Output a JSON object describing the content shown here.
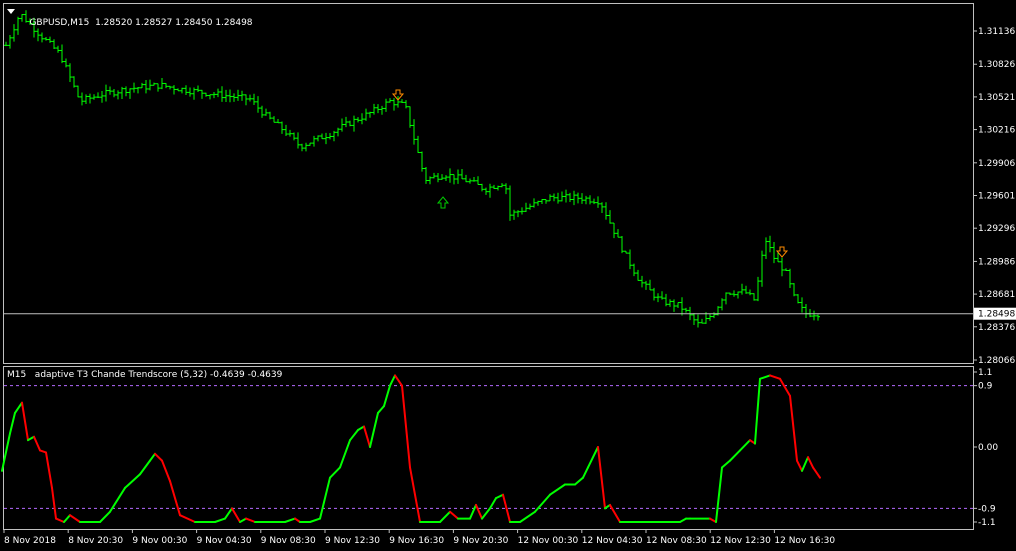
{
  "main_chart": {
    "symbol": "GBPUSD,M15",
    "ohlc": "1.28520 1.28527 1.28450 1.28498",
    "price_ticks": [
      "1.31136",
      "1.30826",
      "1.30521",
      "1.30216",
      "1.29906",
      "1.29601",
      "1.29296",
      "1.28986",
      "1.28681",
      "1.28376",
      "1.28066"
    ],
    "current_price": "1.28498",
    "bar_color": "#00ff00",
    "arrow_down_color": "#ff8c00",
    "arrow_up_color": "#00cc00"
  },
  "indicator": {
    "title": "M15   adaptive T3 Chande Trendscore (5,32) -0.4639 -0.4639",
    "levels": [
      "1.1",
      "0.9",
      "0.00",
      "-0.9",
      "-1.1"
    ],
    "up_color": "#00ff00",
    "down_color": "#ff0000",
    "level_color": "#b469ff"
  },
  "time_axis": [
    "8 Nov 2018",
    "8 Nov 20:30",
    "9 Nov 00:30",
    "9 Nov 04:30",
    "9 Nov 08:30",
    "9 Nov 12:30",
    "9 Nov 16:30",
    "9 Nov 20:30",
    "12 Nov 00:30",
    "12 Nov 04:30",
    "12 Nov 08:30",
    "12 Nov 12:30",
    "12 Nov 16:30"
  ],
  "chart_data": [
    {
      "type": "line",
      "title": "GBPUSD,M15",
      "ylim": [
        1.28066,
        1.3135
      ],
      "y_ticks": [
        1.31136,
        1.30826,
        1.30521,
        1.30216,
        1.29906,
        1.29601,
        1.29296,
        1.28986,
        1.28681,
        1.28376,
        1.28066
      ],
      "close_points": [
        [
          4,
          1.3096
        ],
        [
          20,
          1.313
        ],
        [
          40,
          1.311
        ],
        [
          60,
          1.3092
        ],
        [
          80,
          1.3048
        ],
        [
          100,
          1.3054
        ],
        [
          130,
          1.306
        ],
        [
          160,
          1.3063
        ],
        [
          190,
          1.3058
        ],
        [
          220,
          1.3054
        ],
        [
          250,
          1.305
        ],
        [
          265,
          1.3035
        ],
        [
          285,
          1.302
        ],
        [
          300,
          1.3006
        ],
        [
          330,
          1.3018
        ],
        [
          350,
          1.3028
        ],
        [
          370,
          1.3037
        ],
        [
          390,
          1.3048
        ],
        [
          405,
          1.3044
        ],
        [
          415,
          1.301
        ],
        [
          425,
          1.2975
        ],
        [
          445,
          1.298
        ],
        [
          470,
          1.2973
        ],
        [
          485,
          1.2966
        ],
        [
          505,
          1.2973
        ],
        [
          510,
          1.2942
        ],
        [
          530,
          1.295
        ],
        [
          550,
          1.2958
        ],
        [
          580,
          1.2958
        ],
        [
          600,
          1.2955
        ],
        [
          610,
          1.2935
        ],
        [
          625,
          1.2905
        ],
        [
          640,
          1.288
        ],
        [
          660,
          1.2862
        ],
        [
          680,
          1.2857
        ],
        [
          700,
          1.2838
        ],
        [
          715,
          1.2852
        ],
        [
          725,
          1.287
        ],
        [
          745,
          1.287
        ],
        [
          755,
          1.2862
        ],
        [
          765,
          1.292
        ],
        [
          775,
          1.29
        ],
        [
          785,
          1.289
        ],
        [
          795,
          1.2862
        ],
        [
          805,
          1.285
        ],
        [
          820,
          1.285
        ]
      ]
    },
    {
      "type": "line",
      "title": "adaptive T3 Chande Trendscore (5,32)",
      "ylim": [
        -1.1,
        1.1
      ],
      "y_ticks": [
        1.1,
        0.9,
        0.0,
        -0.9,
        -1.1
      ],
      "series": [
        {
          "values": [
            [
              2,
              -0.35
            ],
            [
              10,
              0.2
            ],
            [
              15,
              0.5
            ],
            [
              22,
              0.65
            ],
            [
              28,
              0.1
            ],
            [
              34,
              0.15
            ],
            [
              40,
              -0.05
            ],
            [
              46,
              -0.08
            ],
            [
              52,
              -0.6
            ],
            [
              56,
              -1.05
            ],
            [
              64,
              -1.1
            ],
            [
              70,
              -1.0
            ],
            [
              80,
              -1.1
            ],
            [
              100,
              -1.1
            ],
            [
              110,
              -0.95
            ],
            [
              125,
              -0.6
            ],
            [
              140,
              -0.4
            ],
            [
              150,
              -0.2
            ],
            [
              155,
              -0.1
            ],
            [
              162,
              -0.2
            ],
            [
              170,
              -0.5
            ],
            [
              180,
              -1.0
            ],
            [
              195,
              -1.1
            ],
            [
              215,
              -1.1
            ],
            [
              225,
              -1.05
            ],
            [
              232,
              -0.9
            ],
            [
              240,
              -1.1
            ],
            [
              246,
              -1.05
            ],
            [
              255,
              -1.1
            ],
            [
              285,
              -1.1
            ],
            [
              295,
              -1.05
            ],
            [
              300,
              -1.1
            ],
            [
              310,
              -1.1
            ],
            [
              320,
              -1.05
            ],
            [
              330,
              -0.45
            ],
            [
              340,
              -0.3
            ],
            [
              350,
              0.1
            ],
            [
              358,
              0.25
            ],
            [
              364,
              0.3
            ],
            [
              370,
              0.0
            ],
            [
              378,
              0.5
            ],
            [
              384,
              0.6
            ],
            [
              390,
              0.9
            ],
            [
              395,
              1.05
            ],
            [
              402,
              0.9
            ],
            [
              410,
              -0.3
            ],
            [
              420,
              -1.1
            ],
            [
              440,
              -1.1
            ],
            [
              450,
              -0.95
            ],
            [
              458,
              -1.05
            ],
            [
              470,
              -1.05
            ],
            [
              476,
              -0.85
            ],
            [
              482,
              -1.05
            ],
            [
              490,
              -0.9
            ],
            [
              496,
              -0.75
            ],
            [
              503,
              -0.7
            ],
            [
              510,
              -1.1
            ],
            [
              520,
              -1.1
            ],
            [
              535,
              -0.95
            ],
            [
              550,
              -0.7
            ],
            [
              565,
              -0.55
            ],
            [
              575,
              -0.55
            ],
            [
              583,
              -0.45
            ],
            [
              588,
              -0.3
            ],
            [
              598,
              0.0
            ],
            [
              605,
              -0.9
            ],
            [
              610,
              -0.85
            ],
            [
              620,
              -1.1
            ],
            [
              680,
              -1.1
            ],
            [
              686,
              -1.05
            ],
            [
              690,
              -1.05
            ],
            [
              710,
              -1.05
            ],
            [
              716,
              -1.1
            ],
            [
              722,
              -0.3
            ],
            [
              730,
              -0.2
            ],
            [
              740,
              -0.05
            ],
            [
              750,
              0.1
            ],
            [
              755,
              0.05
            ],
            [
              760,
              1.0
            ],
            [
              770,
              1.05
            ],
            [
              780,
              1.0
            ],
            [
              790,
              0.75
            ],
            [
              797,
              -0.2
            ],
            [
              802,
              -0.35
            ],
            [
              808,
              -0.15
            ],
            [
              813,
              -0.3
            ],
            [
              820,
              -0.45
            ]
          ]
        }
      ]
    }
  ]
}
